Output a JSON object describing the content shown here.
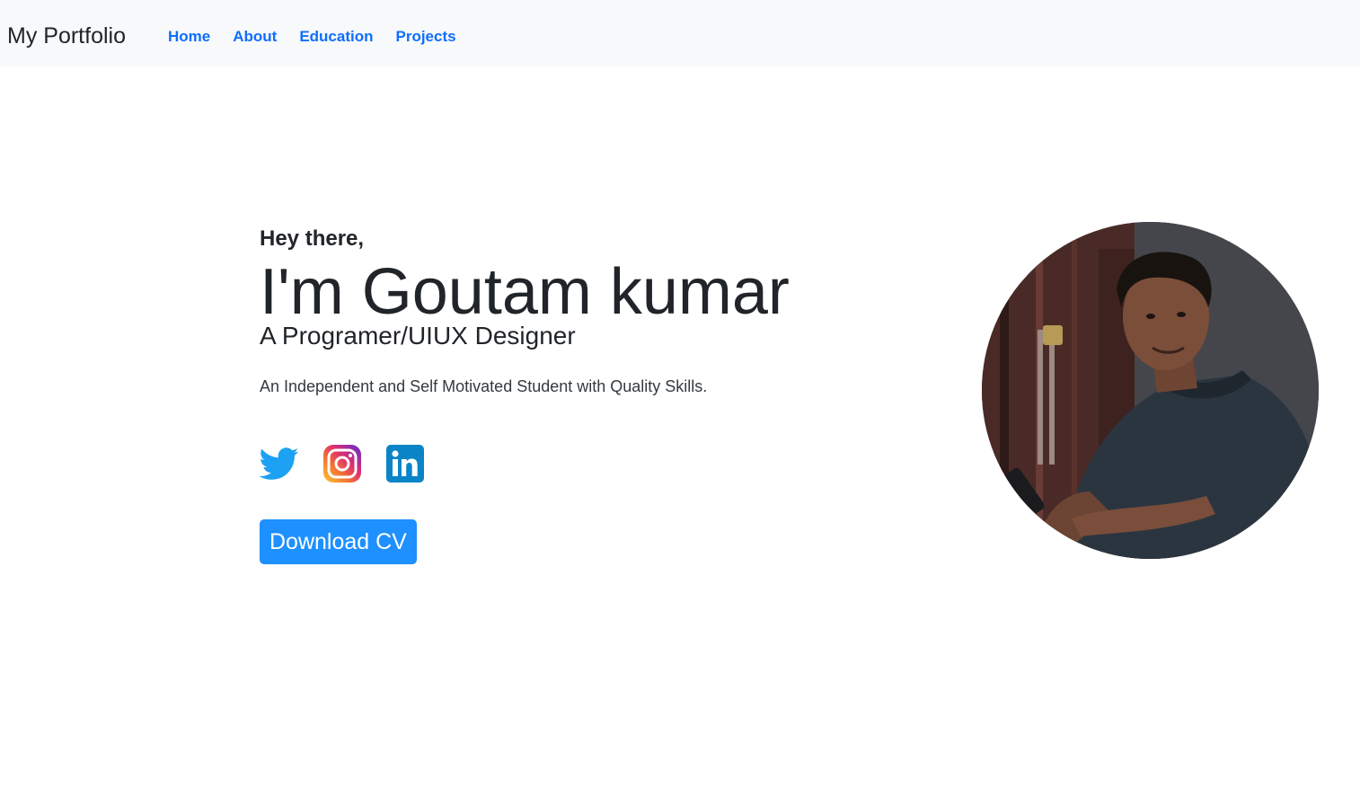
{
  "nav": {
    "brand": "My Portfolio",
    "links": [
      "Home",
      "About",
      "Education",
      "Projects"
    ]
  },
  "hero": {
    "greeting": "Hey there,",
    "name": "I'm Goutam kumar",
    "role": "A Programer/UIUX Designer",
    "tagline": "An Independent and Self Motivated Student with Quality Skills.",
    "socials": [
      {
        "icon": "twitter-icon",
        "color": "#1da1f2"
      },
      {
        "icon": "instagram-icon",
        "color": "#e1306c"
      },
      {
        "icon": "linkedin-icon",
        "color": "#0a84c6"
      }
    ],
    "cta_label": "Download CV",
    "cta_color": "#1e90ff"
  },
  "profile_photo": {
    "description_icon": "profile-photo"
  }
}
